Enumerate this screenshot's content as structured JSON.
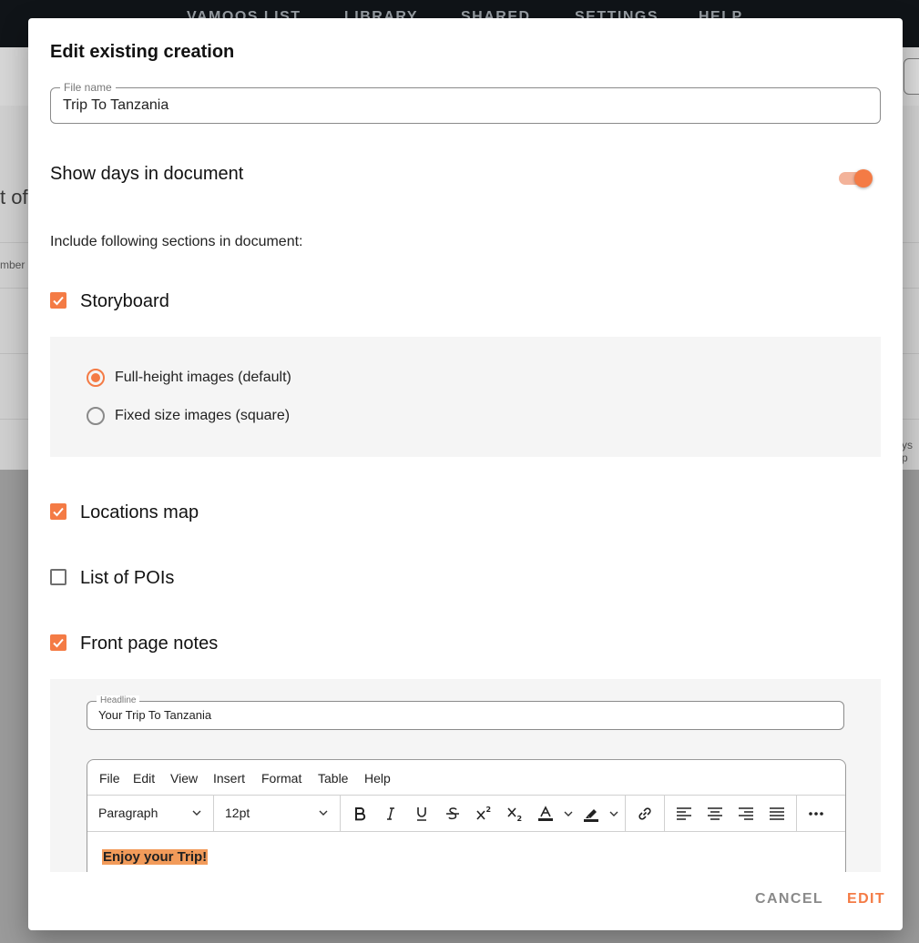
{
  "background": {
    "nav": [
      "VAMOOS LIST",
      "LIBRARY",
      "SHARED",
      "SETTINGS",
      "HELP"
    ],
    "partial_heading": "t of",
    "partial_column": "mber",
    "partial_right": "ys p"
  },
  "dialog": {
    "title": "Edit existing creation",
    "file_name": {
      "label": "File name",
      "value": "Trip To Tanzania"
    },
    "show_days": {
      "label": "Show days in document",
      "enabled": true
    },
    "sections_intro": "Include following sections in document:",
    "sections": {
      "storyboard": {
        "label": "Storyboard",
        "checked": true
      },
      "locations_map": {
        "label": "Locations map",
        "checked": true
      },
      "list_of_pois": {
        "label": "List of POIs",
        "checked": false
      },
      "front_page_notes": {
        "label": "Front page notes",
        "checked": true
      }
    },
    "storyboard_options": [
      {
        "label": "Full-height images (default)",
        "selected": true
      },
      {
        "label": "Fixed size images (square)",
        "selected": false
      }
    ],
    "headline": {
      "label": "Headline",
      "value": "Your Trip To Tanzania"
    },
    "editor": {
      "menu": [
        "File",
        "Edit",
        "View",
        "Insert",
        "Format",
        "Table",
        "Help"
      ],
      "block_format": "Paragraph",
      "font_size": "12pt",
      "content": "Enjoy your Trip!"
    },
    "buttons": {
      "cancel": "CANCEL",
      "edit": "EDIT"
    }
  },
  "colors": {
    "accent": "#f47b45",
    "highlight": "#f29b5a"
  }
}
